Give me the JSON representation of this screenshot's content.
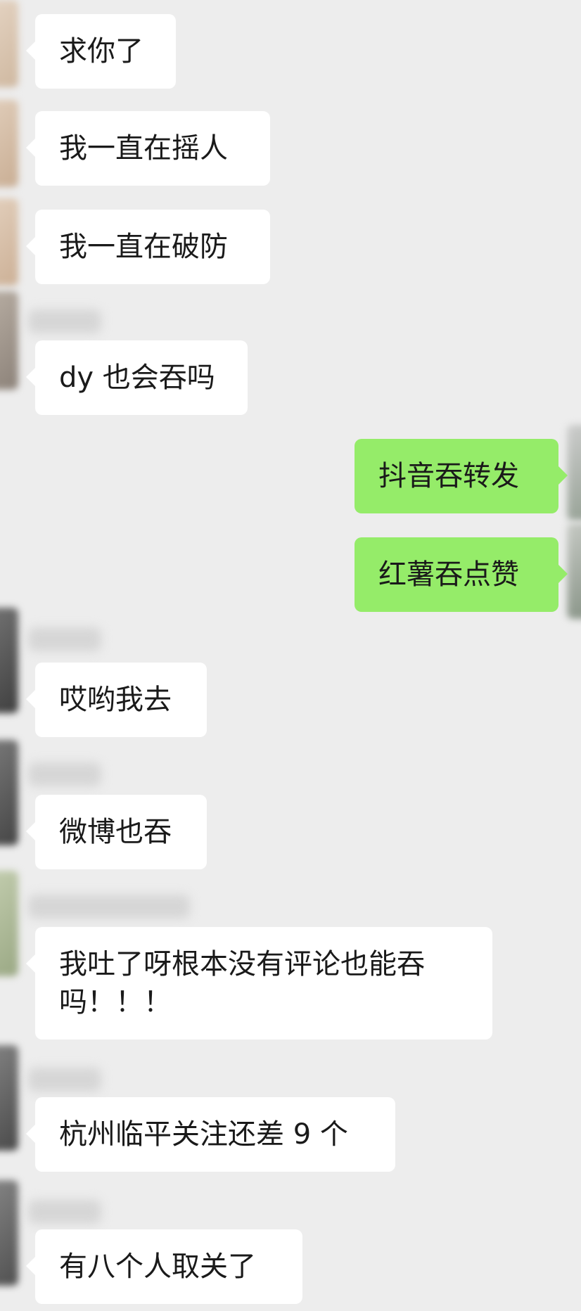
{
  "chat": {
    "theme": {
      "background": "#ededed",
      "incoming_bubble": "#ffffff",
      "outgoing_bubble": "#95ec69"
    },
    "messages": [
      {
        "direction": "incoming",
        "text": "求你了"
      },
      {
        "direction": "incoming",
        "text": "我一直在摇人"
      },
      {
        "direction": "incoming",
        "text": "我一直在破防"
      },
      {
        "direction": "incoming",
        "text": "dy 也会吞吗"
      },
      {
        "direction": "outgoing",
        "text": "抖音吞转发"
      },
      {
        "direction": "outgoing",
        "text": "红薯吞点赞"
      },
      {
        "direction": "incoming",
        "text": "哎哟我去"
      },
      {
        "direction": "incoming",
        "text": "微博也吞"
      },
      {
        "direction": "incoming",
        "text": "我吐了呀根本没有评论也能吞吗！！！"
      },
      {
        "direction": "incoming",
        "text": "杭州临平关注还差 9 个"
      },
      {
        "direction": "incoming",
        "text": "有八个人取关了"
      }
    ]
  }
}
